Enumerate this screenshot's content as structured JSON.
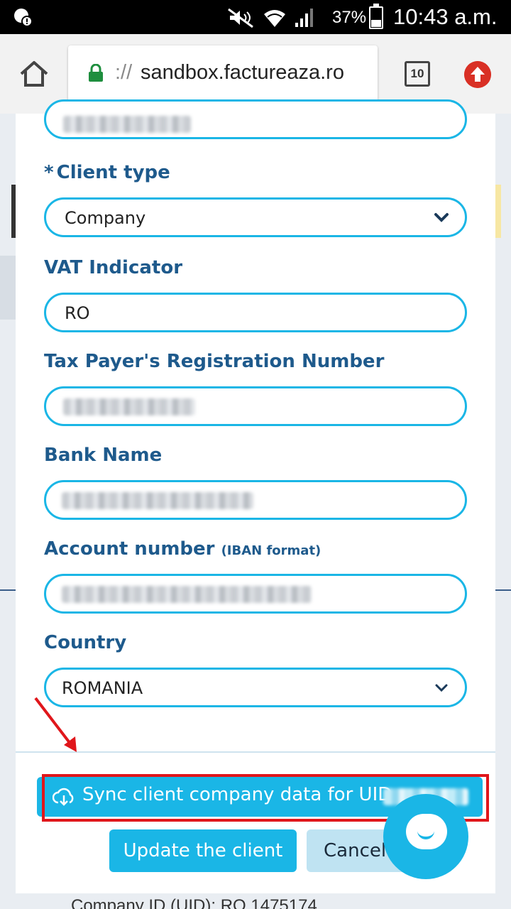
{
  "status_bar": {
    "battery_percent": "37%",
    "battery_level": 0.37,
    "time": "10:43 a.m.",
    "icons": [
      "app-notification-icon",
      "mute-icon",
      "wifi-icon",
      "signal-icon",
      "battery-icon"
    ]
  },
  "browser": {
    "url_prefix": "://",
    "url_host": "sandbox.factureaza.ro",
    "tab_count": "10"
  },
  "form": {
    "client_type": {
      "required_mark": "*",
      "label": "Client type",
      "value": "Company"
    },
    "vat_indicator": {
      "label": "VAT Indicator",
      "value": "RO"
    },
    "tax_id": {
      "label": "Tax Payer's Registration Number"
    },
    "bank_name": {
      "label": "Bank Name"
    },
    "account_number": {
      "label": "Account number",
      "label_suffix": "(IBAN format)"
    },
    "country": {
      "label": "Country",
      "value": "ROMANIA"
    }
  },
  "actions": {
    "sync_label": "Sync client company data for UID",
    "update_label": "Update the client",
    "cancel_label": "Cancel"
  },
  "background": {
    "bottom_text": "Company ID (UID): RO 1475174"
  },
  "colors": {
    "accent": "#1ab6e6",
    "label": "#1e5a8c",
    "highlight": "#e0161b"
  }
}
